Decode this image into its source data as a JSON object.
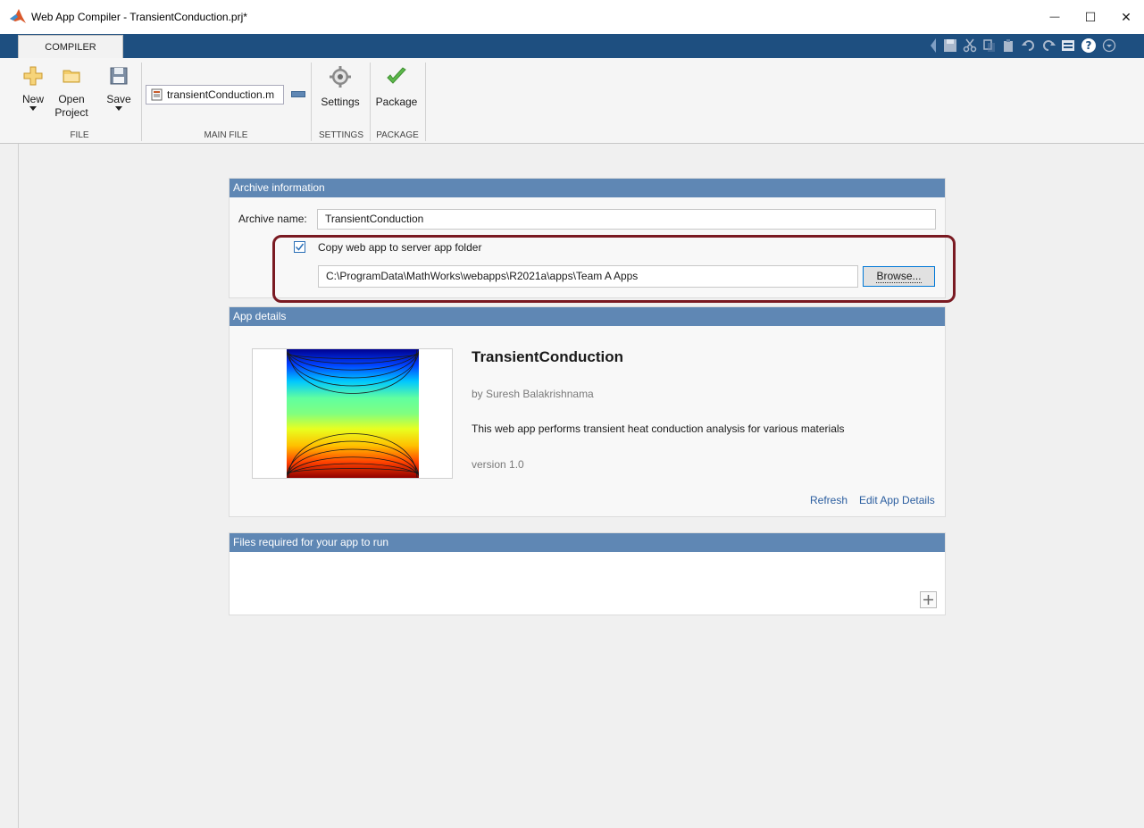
{
  "window": {
    "title": "Web App Compiler - TransientConduction.prj*",
    "controls": {
      "minimize": "—",
      "maximize": "☐",
      "close": "✕"
    }
  },
  "tabs": [
    {
      "label": "COMPILER",
      "active": true
    }
  ],
  "quick_access": [
    "save-icon",
    "cut-icon",
    "copy-icon",
    "paste-icon",
    "undo-icon",
    "redo-icon",
    "layout-icon",
    "help-icon",
    "chevron-down-icon"
  ],
  "ribbon": {
    "file": {
      "label": "FILE",
      "new": {
        "label": "New"
      },
      "open": {
        "label": "Open",
        "label2": "Project"
      },
      "save": {
        "label": "Save"
      }
    },
    "main_file": {
      "label": "MAIN FILE",
      "value": "transientConduction.m"
    },
    "settings": {
      "label": "SETTINGS",
      "button": "Settings"
    },
    "package": {
      "label": "PACKAGE",
      "button": "Package"
    }
  },
  "archive": {
    "header": "Archive information",
    "name_label": "Archive name:",
    "name_value": "TransientConduction",
    "copy_label": "Copy web app to server app folder",
    "copy_checked": true,
    "path_value": "C:\\ProgramData\\MathWorks\\webapps\\R2021a\\apps\\Team A Apps",
    "browse_label": "Browse..."
  },
  "app_details": {
    "header": "App details",
    "name": "TransientConduction",
    "author": "by Suresh Balakrishnama",
    "description": "This web app performs transient heat conduction analysis for various materials",
    "version": "version 1.0",
    "refresh_label": "Refresh",
    "edit_label": "Edit App Details"
  },
  "files_required": {
    "header": "Files required for your app to run",
    "add_icon": "plus-icon"
  },
  "colors": {
    "tab_strip": "#1e4f80",
    "panel_header": "#5f87b4",
    "highlight": "#7a1a22",
    "link": "#2a5d9f"
  }
}
